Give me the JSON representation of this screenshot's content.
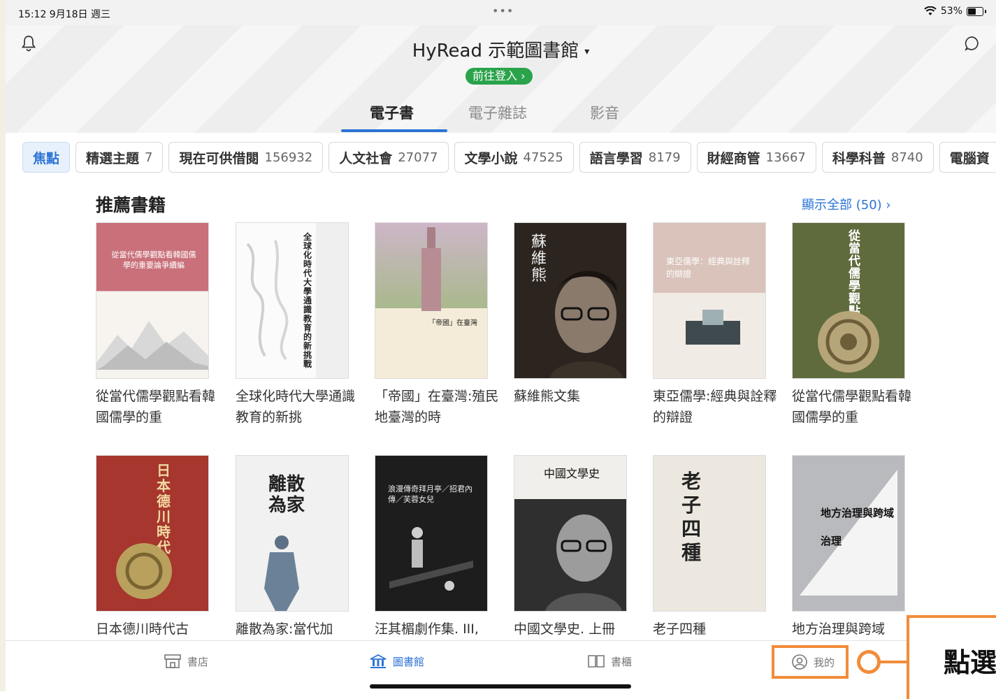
{
  "status_bar": {
    "time": "15:12  9月18日 週三",
    "dots": "•••",
    "battery_percent": "53%"
  },
  "header": {
    "library_title": "HyRead 示範圖書館",
    "dropdown_caret": "▾",
    "login_label": "前往登入 ›",
    "tabs": [
      {
        "label": "電子書",
        "active": true
      },
      {
        "label": "電子雜誌",
        "active": false
      },
      {
        "label": "影音",
        "active": false
      }
    ]
  },
  "categories": [
    {
      "name": "焦點",
      "count": "",
      "active": true
    },
    {
      "name": "精選主題",
      "count": "7"
    },
    {
      "name": "現在可供借閱",
      "count": "156932"
    },
    {
      "name": "人文社會",
      "count": "27077"
    },
    {
      "name": "文學小說",
      "count": "47525"
    },
    {
      "name": "語言學習",
      "count": "8179"
    },
    {
      "name": "財經商管",
      "count": "13667"
    },
    {
      "name": "科學科普",
      "count": "8740"
    },
    {
      "name": "電腦資",
      "count": ""
    }
  ],
  "section": {
    "title": "推薦書籍",
    "show_all": "顯示全部 (50)  ›"
  },
  "books": [
    {
      "title": "從當代儒學觀點看韓國儒學的重",
      "cover_text": "從當代儒學觀點看韓國儒學的重要論爭續編"
    },
    {
      "title": "全球化時代大學通識教育的新挑",
      "cover_text": "全球化時代大學通識教育的新挑戰"
    },
    {
      "title": "「帝國」在臺灣:殖民地臺灣的時",
      "cover_text": "「帝國」在臺灣"
    },
    {
      "title": "蘇維熊文集",
      "cover_text": "蘇維熊"
    },
    {
      "title": "東亞儒學:經典與詮釋的辯證",
      "cover_text": "東亞儒學：經典與詮釋的辯證"
    },
    {
      "title": "從當代儒學觀點看韓國儒學的重",
      "cover_text": "從當代儒學觀點"
    },
    {
      "title": "日本德川時代古",
      "cover_text": "日本德川時代"
    },
    {
      "title": "離散為家:當代加",
      "cover_text": "離散為家"
    },
    {
      "title": "汪其楣劇作集. III,",
      "cover_text": "浪漫傳奇拜月亭／招君內傳／芙蓉女兒"
    },
    {
      "title": "中國文學史. 上冊",
      "cover_text": "中國文學史"
    },
    {
      "title": "老子四種",
      "cover_text": "老子四種"
    },
    {
      "title": "地方治理與跨域",
      "cover_text": "地方治理與跨域治理"
    }
  ],
  "bottom_nav": [
    {
      "label": "書店",
      "icon": "store-icon"
    },
    {
      "label": "圖書館",
      "icon": "library-icon",
      "active": true
    },
    {
      "label": "書櫃",
      "icon": "bookshelf-icon"
    },
    {
      "label": "我的",
      "icon": "profile-icon"
    }
  ],
  "callout": {
    "text": "點選"
  },
  "colors": {
    "accent": "#2b73d6",
    "login_green": "#2aa34a",
    "callout_orange": "#f28c3a"
  }
}
